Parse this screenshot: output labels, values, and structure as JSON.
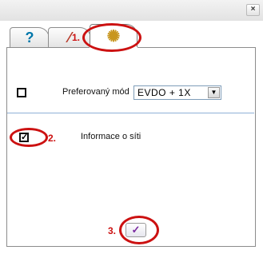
{
  "window": {
    "close_glyph": "×"
  },
  "tabs": [
    {
      "icon": "help-icon",
      "glyph": "?",
      "color": "#0077aa"
    },
    {
      "icon": "tools-icon",
      "glyph": "⁄",
      "color": "#b83a2a"
    },
    {
      "icon": "settings-icon",
      "glyph": "✺",
      "color": "#c8961e"
    }
  ],
  "settings": {
    "preferred_mode": {
      "label": "Preferovaný mód",
      "checked": false,
      "value": "EVDO + 1X"
    },
    "network_info": {
      "label": "Informace o síti",
      "checked": true
    }
  },
  "ok_button": {
    "glyph": "✓"
  },
  "annotations": {
    "step1": "1.",
    "step2": "2.",
    "step3": "3."
  },
  "colors": {
    "annotation": "#cc1111",
    "separator": "#8fb0d6"
  }
}
